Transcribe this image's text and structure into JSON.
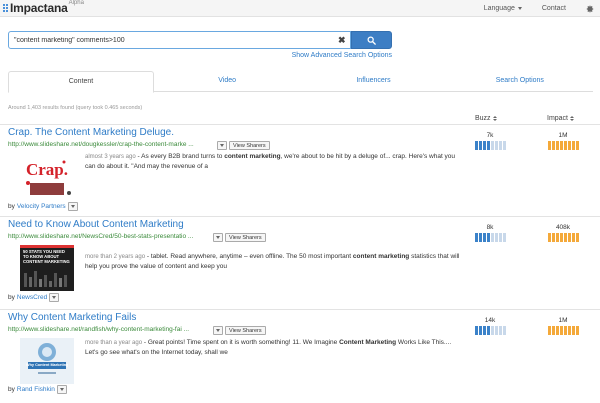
{
  "app": {
    "logo": "Impactana",
    "badge": "Alpha",
    "nav": {
      "language": "Language",
      "contact": "Contact"
    }
  },
  "search": {
    "query": "\"content marketing\" comments>100",
    "clear": "✖",
    "advanced_link": "Show Advanced Search Options"
  },
  "tabs": [
    {
      "label": "Content",
      "active": true
    },
    {
      "label": "Video",
      "active": false
    },
    {
      "label": "Influencers",
      "active": false
    },
    {
      "label": "Search Options",
      "active": false
    }
  ],
  "results_info": "Around 1,403 results found (query took 0.465 seconds)",
  "columns": {
    "buzz": "Buzz",
    "impact": "Impact"
  },
  "colors": {
    "buzz_on": "#3b82c9",
    "buzz_off": "#c8d8ea",
    "impact_on": "#f4a93a",
    "impact_off": "#f7dfb8",
    "link": "#2f7cc7",
    "url": "#3a8a3a"
  },
  "results": [
    {
      "title": "Crap. The Content Marketing Deluge.",
      "url": "http://www.slideshare.net/dougkessler/crap-the-content-marke ...",
      "view_sharers": "View Sharers",
      "age": "almost 3 years ago",
      "snippet_pre": " - As every B2B brand turns to ",
      "snippet_bold": "content marketing",
      "snippet_post": ", we're about to be hit by a deluge of... crap. Here's what you can do about it. \"And may the revenue of a",
      "by_label": "by",
      "author": "Velocity Partners",
      "thumb_text": "Crap.",
      "buzz": "7k",
      "buzz_level": 4,
      "impact": "1M",
      "impact_level": 8
    },
    {
      "title": "Need to Know About Content Marketing",
      "url": "http://www.slideshare.net/NewsCred/50-best-stats-presentatio ...",
      "view_sharers": "View Sharers",
      "age": "more than 2 years ago",
      "snippet_pre": " - tablet. Read anywhere, anytime – even offline. The 50 most important ",
      "snippet_bold": "content marketing",
      "snippet_post": " statistics that will help you prove the value of content and keep you",
      "by_label": "by",
      "author": "NewsCred",
      "thumb_text": "50 STATS YOU NEED TO KNOW ABOUT CONTENT MARKETING",
      "buzz": "8k",
      "buzz_level": 4,
      "impact": "408k",
      "impact_level": 8
    },
    {
      "title": "Why Content Marketing Fails",
      "url": "http://www.slideshare.net/randfish/why-content-marketing-fai ...",
      "view_sharers": "View Sharers",
      "age": "more than a year ago",
      "snippet_pre": " - Great points! Time spent on it is worth something! 11. We Imagine ",
      "snippet_bold": "Content Marketing",
      "snippet_post": " Works Like This.... Let's go see what's on the Internet today, shall we",
      "by_label": "by",
      "author": "Rand Fishkin",
      "thumb_text": "Why Content Marketing Fails",
      "buzz": "14k",
      "buzz_level": 4,
      "impact": "1M",
      "impact_level": 8
    }
  ]
}
